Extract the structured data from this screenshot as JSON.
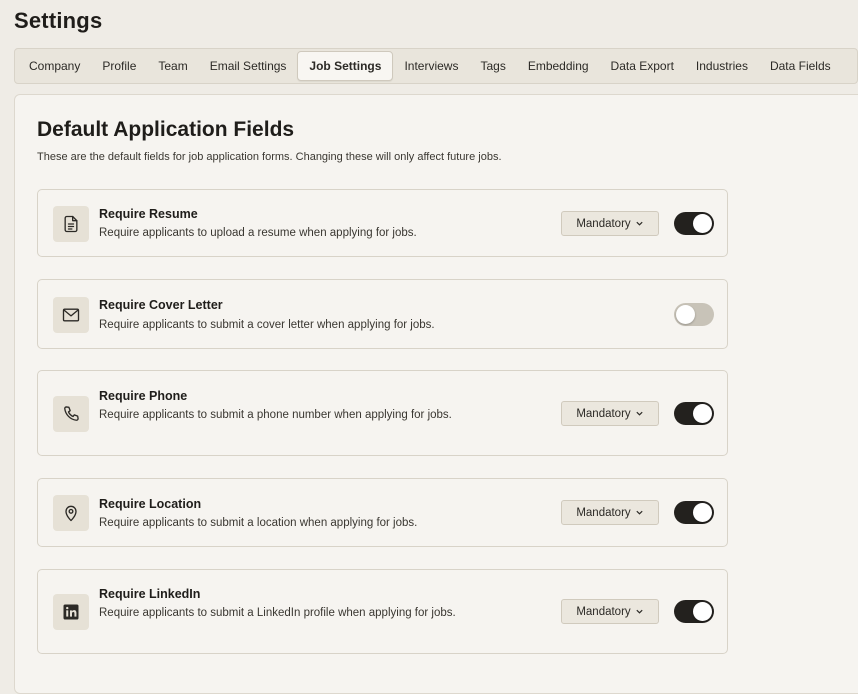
{
  "page": {
    "title": "Settings"
  },
  "tabs": [
    {
      "label": "Company"
    },
    {
      "label": "Profile"
    },
    {
      "label": "Team"
    },
    {
      "label": "Email Settings"
    },
    {
      "label": "Job Settings",
      "active": true
    },
    {
      "label": "Interviews"
    },
    {
      "label": "Tags"
    },
    {
      "label": "Embedding"
    },
    {
      "label": "Data Export"
    },
    {
      "label": "Industries"
    },
    {
      "label": "Data Fields"
    }
  ],
  "section": {
    "title": "Default Application Fields",
    "description": "These are the default fields for job application forms. Changing these will only affect future jobs."
  },
  "fields": [
    {
      "icon": "document-icon",
      "title": "Require Resume",
      "description": "Require applicants to upload a resume when applying for jobs.",
      "requirement": "Mandatory",
      "enabled": true
    },
    {
      "icon": "mail-icon",
      "title": "Require Cover Letter",
      "description": "Require applicants to submit a cover letter when applying for jobs.",
      "requirement": "",
      "enabled": false
    },
    {
      "icon": "phone-icon",
      "title": "Require Phone",
      "description": "Require applicants to submit a phone number when applying for jobs.",
      "requirement": "Mandatory",
      "enabled": true
    },
    {
      "icon": "location-pin-icon",
      "title": "Require Location",
      "description": "Require applicants to submit a location when applying for jobs.",
      "requirement": "Mandatory",
      "enabled": true
    },
    {
      "icon": "linkedin-icon",
      "title": "Require LinkedIn",
      "description": "Require applicants to submit a LinkedIn profile when applying for jobs.",
      "requirement": "Mandatory",
      "enabled": true
    }
  ],
  "colors": {
    "background": "#efece6",
    "panel": "#f6f4f0",
    "toggle_on": "#23211e",
    "toggle_off": "#c8c3b8",
    "icon_box": "#e6e1d6"
  }
}
